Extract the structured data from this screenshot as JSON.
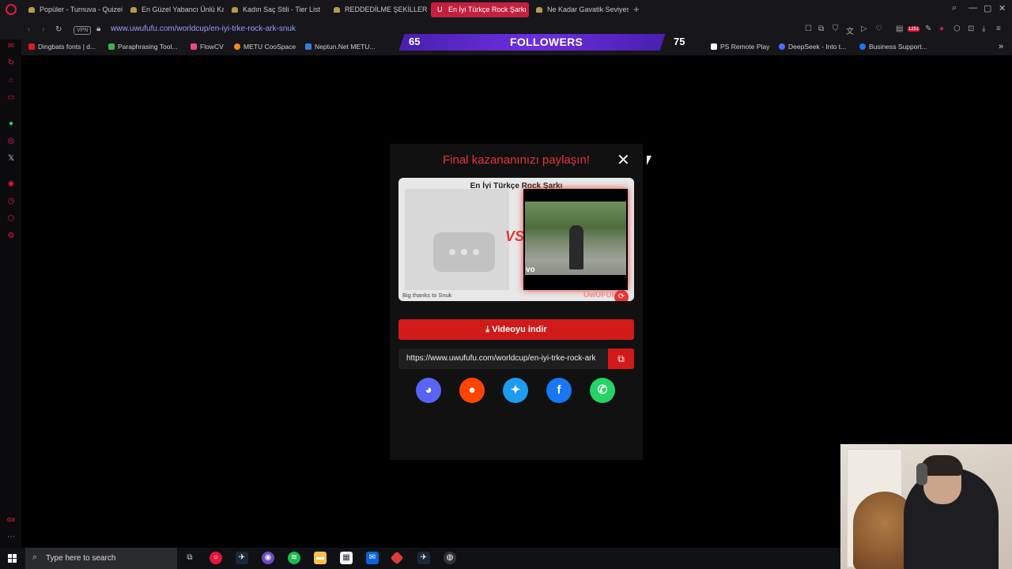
{
  "browser": {
    "tabs": [
      {
        "label": "Popüler - Turnuva - Quizei",
        "active": false
      },
      {
        "label": "En Güzel Yabancı Ünlü Ka",
        "active": false
      },
      {
        "label": "Kadın Saç Stili - Tier List",
        "active": false
      },
      {
        "label": "REDDEDİLME ŞEKİLLERİ |",
        "active": false
      },
      {
        "label": "En İyi Türkçe Rock Şarkı |",
        "active": true
      },
      {
        "label": "Ne Kadar Gavatik Seviyes",
        "active": false
      }
    ],
    "active_tab_favicon": "U",
    "new_tab": "+",
    "vpn_label": "VPN",
    "url_host": "www.uwufufu.com",
    "url_path": "/worldcup/en-iyi-trke-rock-ark-snuk",
    "bookmarks": [
      {
        "label": "Dingbats fonts | d...",
        "color": "#e01c1c"
      },
      {
        "label": "Paraphrasing Tool...",
        "color": "#3ab54a"
      },
      {
        "label": "FlowCV",
        "color": "#e84a8c"
      },
      {
        "label": "METU CooSpace",
        "color": "#f08a24"
      },
      {
        "label": "Neptun.Net METU...",
        "color": "#3a7be0"
      },
      {
        "label": "PS Remote Play",
        "color": "#ffffff"
      },
      {
        "label": "DeepSeek - Into t...",
        "color": "#4d6bfe"
      },
      {
        "label": "Business Support...",
        "color": "#1877f2"
      }
    ],
    "extension_badge": "1251"
  },
  "stream_overlay": {
    "followers_label": "FOLLOWERS",
    "current": "65",
    "goal": "75"
  },
  "modal": {
    "title": "Final kazananınızı paylaşın!",
    "card": {
      "title": "En İyi Türkçe Rock Şarkı",
      "vs_label": "VS",
      "winner_caption": "vo",
      "credit": "Big thanks to Snuk",
      "brand": "UwUFUFU"
    },
    "download_label": "Videoyu indir",
    "share_url": "https://www.uwufufu.com/worldcup/en-iyi-trke-rock-ark",
    "share_buttons": [
      {
        "name": "discord",
        "color": "#5865f2"
      },
      {
        "name": "reddit",
        "color": "#ff4500"
      },
      {
        "name": "twitter",
        "color": "#1d9bf0"
      },
      {
        "name": "facebook",
        "color": "#1877f2"
      },
      {
        "name": "whatsapp",
        "color": "#25d366"
      }
    ]
  },
  "taskbar": {
    "search_placeholder": "Type here to search"
  }
}
